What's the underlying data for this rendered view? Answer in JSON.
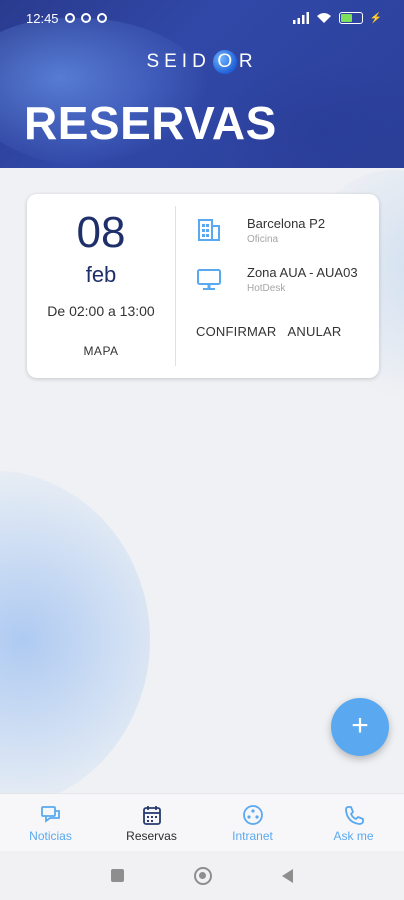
{
  "status_bar": {
    "time": "12:45"
  },
  "header": {
    "logo_left": "SEID",
    "logo_o": "O",
    "logo_right": "R",
    "title": "RESERVAS"
  },
  "reservation": {
    "day": "08",
    "month": "feb",
    "time_range": "De 02:00 a 13:00",
    "map_label": "MAPA",
    "location": {
      "name": "Barcelona P2",
      "type": "Oficina",
      "icon": "building-icon"
    },
    "desk": {
      "name": "Zona AUA - AUA03",
      "type": "HotDesk",
      "icon": "monitor-icon"
    },
    "confirm_label": "CONFIRMAR",
    "cancel_label": "ANULAR"
  },
  "fab": {
    "label": "+"
  },
  "bottom_nav": [
    {
      "label": "Noticias",
      "icon": "chat-icon",
      "active": false
    },
    {
      "label": "Reservas",
      "icon": "calendar-icon",
      "active": true
    },
    {
      "label": "Intranet",
      "icon": "intranet-icon",
      "active": false
    },
    {
      "label": "Ask me",
      "icon": "phone-icon",
      "active": false
    }
  ],
  "colors": {
    "accent": "#5aa9f0",
    "header": "#2b3f98",
    "date_text": "#1e2f6a"
  }
}
